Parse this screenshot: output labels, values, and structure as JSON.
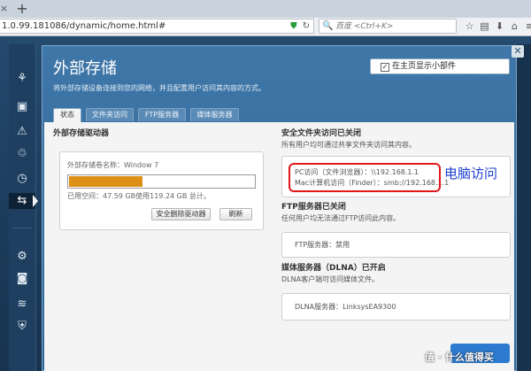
{
  "browser": {
    "url": "1.0.99.181086/dynamic/home.html#",
    "search_placeholder": "百度 <Ctrl+K>",
    "new_tab": "+"
  },
  "dialog": {
    "title": "外部存储",
    "description": "将外部存储设备连接到您的网络，并且配置用户访问其内容的方式。",
    "show_on_homepage": "在主页显示小部件",
    "show_on_homepage_checked": true,
    "tabs": [
      "状态",
      "文件夹访问",
      "FTP服务器",
      "媒体服务器"
    ],
    "active_tab": 0
  },
  "drive": {
    "heading": "外部存储驱动器",
    "volume_label": "外部存储卷名称：Window 7",
    "usage_text": "已用空间：47.59 GB使用119.24 GB 总计。",
    "used_gb": 47.59,
    "total_gb": 119.24,
    "safe_remove_button": "安全删除驱动器",
    "refresh_button": "刷新"
  },
  "secure_folder": {
    "heading": "安全文件夹访问已关闭",
    "desc": "所有用户均可通过共享文件夹访问其内容。",
    "pc_access": "PC访问（文件浏览器）：\\\\192.168.1.1",
    "mac_access": "Mac计算机访问（Finder）：smb://192.168.1.1"
  },
  "annotation": "电脑访问",
  "ftp": {
    "heading": "FTP服务器已关闭",
    "desc": "任何用户均无法通过FTP访问此内容。",
    "server": "FTP服务器：禁用"
  },
  "media": {
    "heading": "媒体服务器（DLNA）已开启",
    "desc": "DLNA客户端可访问媒体文件。",
    "server": "DLNA服务器：LinksysEA9300"
  },
  "watermark": "值 · 什么值得买"
}
